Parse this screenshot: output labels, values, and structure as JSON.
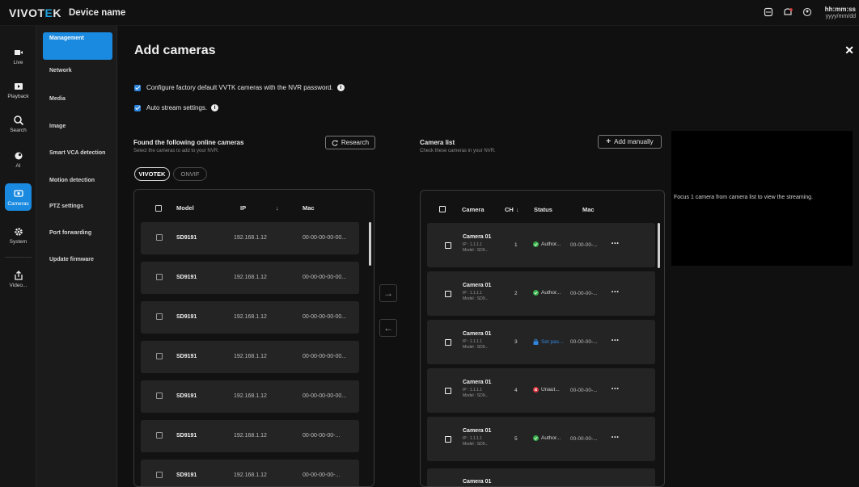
{
  "topbar": {
    "logo_main": "VIVOT",
    "logo_accent": "E",
    "logo_end": "K",
    "device_name": "Device name",
    "time": "hh:mm:ss",
    "date": "yyyy/mm/dd",
    "icons": [
      "server-icon",
      "notification-icon",
      "user-icon"
    ]
  },
  "rail": {
    "items": [
      {
        "label": "Live",
        "icon": "camera-icon"
      },
      {
        "label": "Playback",
        "icon": "playback-icon"
      },
      {
        "label": "Search",
        "icon": "search-icon"
      },
      {
        "label": "AI",
        "icon": "ai-icon"
      },
      {
        "label": "Cameras",
        "icon": "cameras-icon",
        "active": true
      },
      {
        "label": "System",
        "icon": "gear-icon"
      },
      {
        "label": "Video...",
        "icon": "export-icon"
      }
    ]
  },
  "submenu": {
    "items": [
      "Management",
      "Network",
      "Media",
      "Image",
      "Smart VCA detection",
      "Motion detection",
      "PTZ settings",
      "Port forwarding",
      "Update firmware"
    ]
  },
  "page": {
    "title": "Add cameras",
    "option1": "Configure factory default VVTK cameras with the NVR password.",
    "option2": "Auto stream settings."
  },
  "found": {
    "title": "Found the following online cameras",
    "subtitle": "Select the cameras to add to your NVR.",
    "research_label": "Research",
    "filter_vivotek": "VIVOTEK",
    "filter_onvif": "ONVIF",
    "headers": {
      "model": "Model",
      "ip": "IP",
      "mac": "Mac"
    },
    "rows": [
      {
        "model": "SD9191",
        "ip": "192.168.1.12",
        "mac": "00-00-00-00-00..."
      },
      {
        "model": "SD9191",
        "ip": "192.168.1.12",
        "mac": "00-00-00-00-00..."
      },
      {
        "model": "SD9191",
        "ip": "192.168.1.12",
        "mac": "00-00-00-00-00..."
      },
      {
        "model": "SD9191",
        "ip": "192.168.1.12",
        "mac": "00-00-00-00-00..."
      },
      {
        "model": "SD9191",
        "ip": "192.168.1.12",
        "mac": "00-00-00-00-00..."
      },
      {
        "model": "SD9191",
        "ip": "192.168.1.12",
        "mac": "00-00-00-00-..."
      },
      {
        "model": "SD9191",
        "ip": "192.168.1.12",
        "mac": "00-00-00-00-..."
      }
    ]
  },
  "camera_list": {
    "title": "Camera list",
    "subtitle": "Check these cameras in your NVR.",
    "add_label": "Add manually",
    "headers": {
      "camera": "Camera",
      "ch": "CH",
      "status": "Status",
      "mac": "Mac"
    },
    "rows": [
      {
        "name": "Camera 01",
        "ip": "IP : 1.1.1.1",
        "model": "Model : SD9...",
        "ch": "1",
        "status": "Author...",
        "state": "ok",
        "mac": "00-00-00-..."
      },
      {
        "name": "Camera 01",
        "ip": "IP : 1.1.1.1",
        "model": "Model : SD9...",
        "ch": "2",
        "status": "Author...",
        "state": "ok",
        "mac": "00-00-00-..."
      },
      {
        "name": "Camera 01",
        "ip": "IP : 1.1.1.1",
        "model": "Model : SD9...",
        "ch": "3",
        "status": "Set pas...",
        "state": "lock",
        "mac": "00-00-00-..."
      },
      {
        "name": "Camera 01",
        "ip": "IP : 1.1.1.1",
        "model": "Model : SD9...",
        "ch": "4",
        "status": "Unaut...",
        "state": "err",
        "mac": "00-00-00-..."
      },
      {
        "name": "Camera 01",
        "ip": "IP : 1.1.1.1",
        "model": "Model : SD9...",
        "ch": "5",
        "status": "Author...",
        "state": "ok",
        "mac": "00-00-00-..."
      },
      {
        "name": "Camera 01"
      }
    ],
    "more": "•••"
  },
  "preview": {
    "message": "Focus 1 camera from camera list to view the streaming."
  },
  "colors": {
    "accent": "#1a8ae0",
    "ok": "#38b04a",
    "error": "#d9363e",
    "lock": "#2f86e0"
  }
}
